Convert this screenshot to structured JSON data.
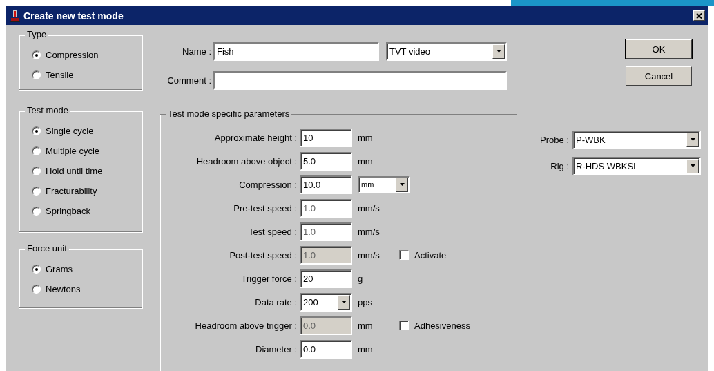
{
  "window": {
    "title": "Create new test mode"
  },
  "type_group": {
    "title": "Type",
    "options": [
      {
        "label": "Compression",
        "selected": true
      },
      {
        "label": "Tensile",
        "selected": false
      }
    ]
  },
  "test_mode_group": {
    "title": "Test mode",
    "options": [
      {
        "label": "Single cycle",
        "selected": true
      },
      {
        "label": "Multiple cycle",
        "selected": false
      },
      {
        "label": "Hold until time",
        "selected": false
      },
      {
        "label": "Fracturability",
        "selected": false
      },
      {
        "label": "Springback",
        "selected": false
      }
    ]
  },
  "force_unit_group": {
    "title": "Force unit",
    "options": [
      {
        "label": "Grams",
        "selected": true
      },
      {
        "label": "Newtons",
        "selected": false
      }
    ]
  },
  "name": {
    "label": "Name :",
    "value": "Fish"
  },
  "video_select": {
    "value": "TVT video"
  },
  "comment": {
    "label": "Comment :"
  },
  "parameters": {
    "title": "Test mode specific parameters",
    "rows": [
      {
        "label": "Approximate height :",
        "field": {
          "kind": "text",
          "value": "10",
          "dimmed": false,
          "disabled": false
        },
        "unit": {
          "kind": "text",
          "value": "mm"
        }
      },
      {
        "label": "Headroom above object :",
        "field": {
          "kind": "text",
          "value": "5.0",
          "dimmed": false,
          "disabled": false
        },
        "unit": {
          "kind": "text",
          "value": "mm"
        }
      },
      {
        "label": "Compression :",
        "field": {
          "kind": "text",
          "value": "10.0",
          "dimmed": false,
          "disabled": false
        },
        "unit": {
          "kind": "select",
          "value": "mm"
        }
      },
      {
        "label": "Pre-test speed :",
        "field": {
          "kind": "text",
          "value": "1.0",
          "dimmed": true,
          "disabled": false
        },
        "unit": {
          "kind": "text",
          "value": "mm/s"
        }
      },
      {
        "label": "Test speed :",
        "field": {
          "kind": "text",
          "value": "1.0",
          "dimmed": true,
          "disabled": false
        },
        "unit": {
          "kind": "text",
          "value": "mm/s"
        }
      },
      {
        "label": "Post-test speed :",
        "field": {
          "kind": "text",
          "value": "1.0",
          "dimmed": true,
          "disabled": true
        },
        "unit": {
          "kind": "text",
          "value": "mm/s"
        },
        "checkbox": {
          "label": "Activate",
          "checked": false
        }
      },
      {
        "label": "Trigger force :",
        "field": {
          "kind": "text",
          "value": "20",
          "dimmed": false,
          "disabled": false
        },
        "unit": {
          "kind": "text",
          "value": "g"
        }
      },
      {
        "label": "Data rate :",
        "field": {
          "kind": "select",
          "value": "200",
          "dimmed": false,
          "disabled": false
        },
        "unit": {
          "kind": "text",
          "value": "pps"
        }
      },
      {
        "label": "Headroom above trigger :",
        "field": {
          "kind": "text",
          "value": "0.0",
          "dimmed": true,
          "disabled": true
        },
        "unit": {
          "kind": "text",
          "value": "mm"
        },
        "checkbox": {
          "label": "Adhesiveness",
          "checked": false
        }
      },
      {
        "label": "Diameter :",
        "field": {
          "kind": "text",
          "value": "0.0",
          "dimmed": false,
          "disabled": false
        },
        "unit": {
          "kind": "text",
          "value": "mm"
        }
      }
    ]
  },
  "buttons": [
    {
      "label": "OK",
      "default": true
    },
    {
      "label": "Cancel",
      "default": false
    }
  ],
  "probe": {
    "label": "Probe :",
    "value": "P-WBK"
  },
  "rig": {
    "label": "Rig :",
    "value": "R-HDS WBKSI"
  }
}
